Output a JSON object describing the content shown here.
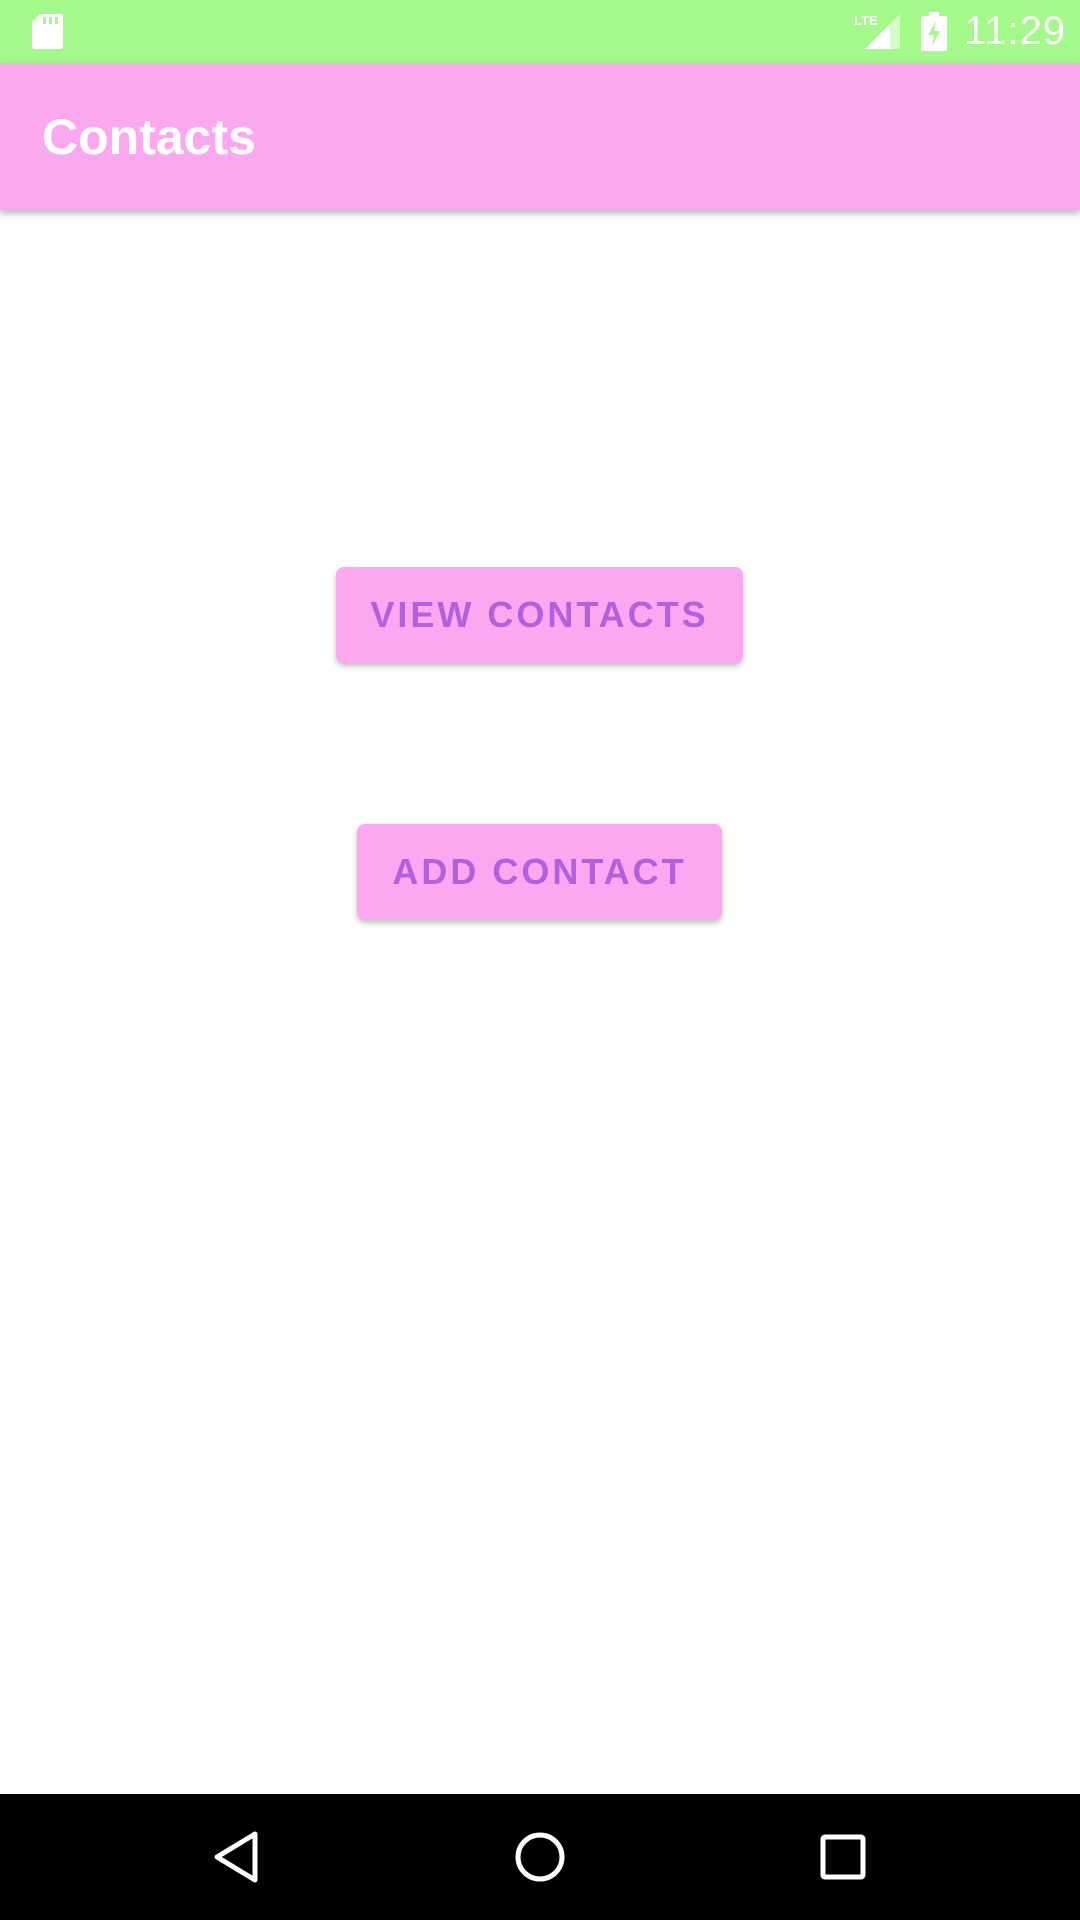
{
  "status_bar": {
    "time": "11:29",
    "network_label": "LTE",
    "icons": [
      "sd-card-icon",
      "lte-signal-icon",
      "battery-charging-icon"
    ],
    "background_color": "#a3f98a"
  },
  "app_bar": {
    "title": "Contacts",
    "background_color": "#fca8f1"
  },
  "main": {
    "buttons": [
      {
        "label": "VIEW CONTACTS"
      },
      {
        "label": "ADD CONTACT"
      }
    ],
    "button_color": "#fca8f1",
    "button_text_color": "#b160e0"
  },
  "nav_bar": {
    "icons": [
      "back-icon",
      "home-icon",
      "recent-apps-icon"
    ]
  }
}
